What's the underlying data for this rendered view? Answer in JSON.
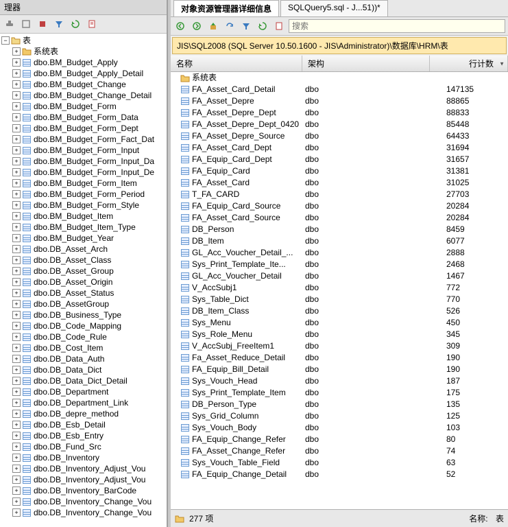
{
  "left": {
    "title": "理器",
    "root_label": "表",
    "sys_label": "系统表",
    "items": [
      "dbo.BM_Budget_Apply",
      "dbo.BM_Budget_Apply_Detail",
      "dbo.BM_Budget_Change",
      "dbo.BM_Budget_Change_Detail",
      "dbo.BM_Budget_Form",
      "dbo.BM_Budget_Form_Data",
      "dbo.BM_Budget_Form_Dept",
      "dbo.BM_Budget_Form_Fact_Dat",
      "dbo.BM_Budget_Form_Input",
      "dbo.BM_Budget_Form_Input_Da",
      "dbo.BM_Budget_Form_Input_De",
      "dbo.BM_Budget_Form_Item",
      "dbo.BM_Budget_Form_Period",
      "dbo.BM_Budget_Form_Style",
      "dbo.BM_Budget_Item",
      "dbo.BM_Budget_Item_Type",
      "dbo.BM_Budget_Year",
      "dbo.DB_Asset_Arch",
      "dbo.DB_Asset_Class",
      "dbo.DB_Asset_Group",
      "dbo.DB_Asset_Origin",
      "dbo.DB_Asset_Status",
      "dbo.DB_AssetGroup",
      "dbo.DB_Business_Type",
      "dbo.DB_Code_Mapping",
      "dbo.DB_Code_Rule",
      "dbo.DB_Cost_Item",
      "dbo.DB_Data_Auth",
      "dbo.DB_Data_Dict",
      "dbo.DB_Data_Dict_Detail",
      "dbo.DB_Department",
      "dbo.DB_Department_Link",
      "dbo.DB_depre_method",
      "dbo.DB_Esb_Detail",
      "dbo.DB_Esb_Entry",
      "dbo.DB_Fund_Src",
      "dbo.DB_Inventory",
      "dbo.DB_Inventory_Adjust_Vou",
      "dbo.DB_Inventory_Adjust_Vou",
      "dbo.DB_Inventory_BarCode",
      "dbo.DB_Inventory_Change_Vou",
      "dbo.DB_Inventory_Change_Vou"
    ]
  },
  "tabs": {
    "tab1": "对象资源管理器详细信息",
    "tab2": "SQLQuery5.sql - J...51))*"
  },
  "search": {
    "placeholder": "搜索"
  },
  "path": "JIS\\SQL2008 (SQL Server 10.50.1600 - JIS\\Administrator)\\数据库\\HRM\\表",
  "columns": {
    "name": "名称",
    "schema": "架构",
    "rows": "行计数"
  },
  "grid": {
    "first_row_label": "系统表",
    "rows": [
      {
        "n": "FA_Asset_Card_Detail",
        "s": "dbo",
        "r": "147135"
      },
      {
        "n": "FA_Asset_Depre",
        "s": "dbo",
        "r": "88865"
      },
      {
        "n": "FA_Asset_Depre_Dept",
        "s": "dbo",
        "r": "88833"
      },
      {
        "n": "FA_Asset_Depre_Dept_0420",
        "s": "dbo",
        "r": "85448"
      },
      {
        "n": "FA_Asset_Depre_Source",
        "s": "dbo",
        "r": "64433"
      },
      {
        "n": "FA_Asset_Card_Dept",
        "s": "dbo",
        "r": "31694"
      },
      {
        "n": "FA_Equip_Card_Dept",
        "s": "dbo",
        "r": "31657"
      },
      {
        "n": "FA_Equip_Card",
        "s": "dbo",
        "r": "31381"
      },
      {
        "n": "FA_Asset_Card",
        "s": "dbo",
        "r": "31025"
      },
      {
        "n": "T_FA_CARD",
        "s": "dbo",
        "r": "27703"
      },
      {
        "n": "FA_Equip_Card_Source",
        "s": "dbo",
        "r": "20284"
      },
      {
        "n": "FA_Asset_Card_Source",
        "s": "dbo",
        "r": "20284"
      },
      {
        "n": "DB_Person",
        "s": "dbo",
        "r": "8459"
      },
      {
        "n": "DB_Item",
        "s": "dbo",
        "r": "6077"
      },
      {
        "n": "GL_Acc_Voucher_Detail_...",
        "s": "dbo",
        "r": "2888"
      },
      {
        "n": "Sys_Print_Template_Ite...",
        "s": "dbo",
        "r": "2468"
      },
      {
        "n": "GL_Acc_Voucher_Detail",
        "s": "dbo",
        "r": "1467"
      },
      {
        "n": "V_AccSubj1",
        "s": "dbo",
        "r": "772"
      },
      {
        "n": "Sys_Table_Dict",
        "s": "dbo",
        "r": "770"
      },
      {
        "n": "DB_Item_Class",
        "s": "dbo",
        "r": "526"
      },
      {
        "n": "Sys_Menu",
        "s": "dbo",
        "r": "450"
      },
      {
        "n": "Sys_Role_Menu",
        "s": "dbo",
        "r": "345"
      },
      {
        "n": "V_AccSubj_FreeItem1",
        "s": "dbo",
        "r": "309"
      },
      {
        "n": "Fa_Asset_Reduce_Detail",
        "s": "dbo",
        "r": "190"
      },
      {
        "n": "FA_Equip_Bill_Detail",
        "s": "dbo",
        "r": "190"
      },
      {
        "n": "Sys_Vouch_Head",
        "s": "dbo",
        "r": "187"
      },
      {
        "n": "Sys_Print_Template_Item",
        "s": "dbo",
        "r": "175"
      },
      {
        "n": "DB_Person_Type",
        "s": "dbo",
        "r": "135"
      },
      {
        "n": "Sys_Grid_Column",
        "s": "dbo",
        "r": "125"
      },
      {
        "n": "Sys_Vouch_Body",
        "s": "dbo",
        "r": "103"
      },
      {
        "n": "FA_Equip_Change_Refer",
        "s": "dbo",
        "r": "80"
      },
      {
        "n": "FA_Asset_Change_Refer",
        "s": "dbo",
        "r": "74"
      },
      {
        "n": "Sys_Vouch_Table_Field",
        "s": "dbo",
        "r": "63"
      },
      {
        "n": "FA_Equip_Change_Detail",
        "s": "dbo",
        "r": "52"
      }
    ]
  },
  "status": {
    "count_label": "277 项",
    "name_label": "名称:",
    "name_value": "表"
  }
}
